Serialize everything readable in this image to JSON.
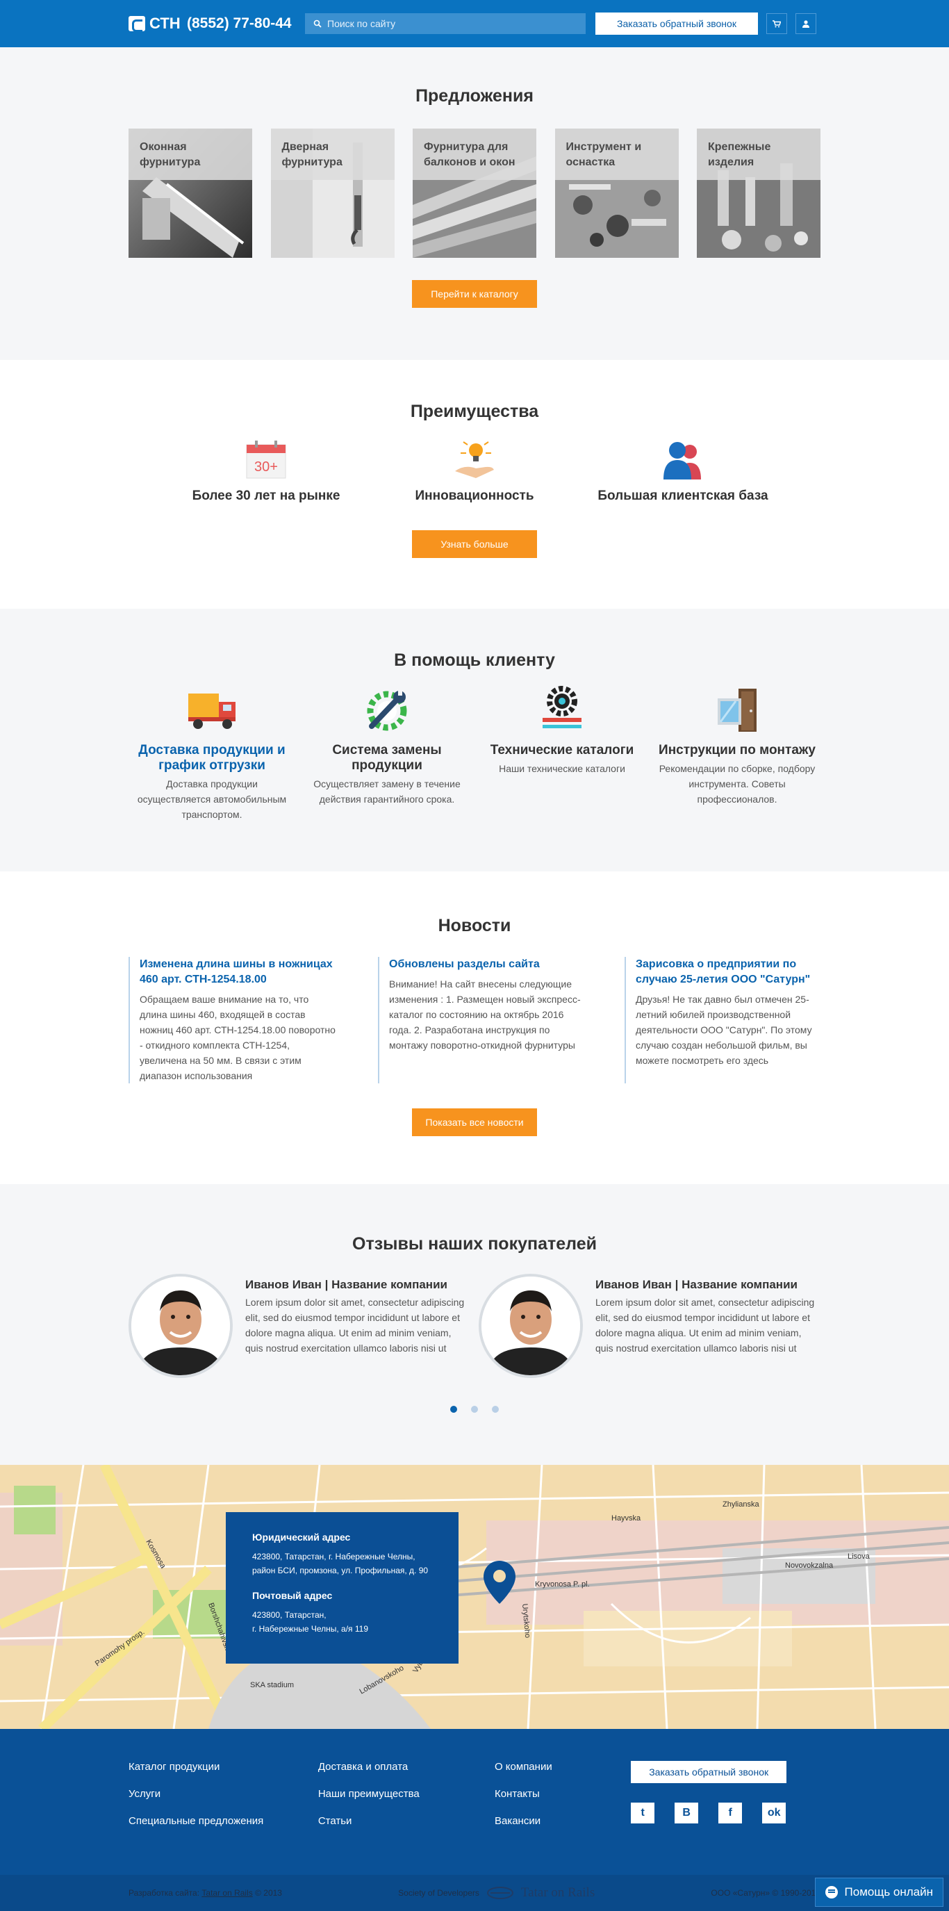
{
  "header": {
    "logo_text": "СТН",
    "phone": "(8552) 77-80-44",
    "search_placeholder": "Поиск по сайту",
    "callback_label": "Заказать обратный звонок",
    "brand_color": "#0a73c0"
  },
  "offers": {
    "title": "Предложения",
    "items": [
      {
        "label": "Оконная фурнитура"
      },
      {
        "label": "Дверная фурнитура"
      },
      {
        "label": "Фурнитура для балконов и окон"
      },
      {
        "label": "Инструмент и оснастка"
      },
      {
        "label": "Крепежные изделия"
      }
    ],
    "button": "Перейти к каталогу"
  },
  "advantages": {
    "title": "Преимущества",
    "items": [
      {
        "icon": "calendar-icon",
        "badge": "30+",
        "label": "Более 30 лет на рынке"
      },
      {
        "icon": "lightbulb-hand-icon",
        "label": "Инновационность"
      },
      {
        "icon": "users-icon",
        "label": "Большая клиентская база"
      }
    ],
    "button": "Узнать больше"
  },
  "help": {
    "title": "В помощь клиенту",
    "items": [
      {
        "icon": "truck-icon",
        "title": "Доставка продукции и график отгрузки",
        "desc": "Доставка продукции осуществляется автомобильным транспортом."
      },
      {
        "icon": "wrench-gear-icon",
        "title": "Система замены продукции",
        "desc": "Осуществляет замену в течение действия гарантийного срока."
      },
      {
        "icon": "gear-ruler-icon",
        "title": "Технические каталоги",
        "desc": "Наши технические каталоги"
      },
      {
        "icon": "window-door-icon",
        "title": "Инструкции по монтажу",
        "desc": "Рекомендации по сборке, подбору инструмента. Советы профессионалов."
      }
    ]
  },
  "news": {
    "title": "Новости",
    "items": [
      {
        "title": "Изменена длина шины в ножницах 460 арт. СТН-1254.18.00",
        "text": "Обращаем ваше внимание на то, что длина шины 460, входящей в состав ножниц 460 арт. СТН-1254.18.00 поворотно - откидного комплекта СТН-1254, увеличена на 50 мм. В связи с этим диапазон использования"
      },
      {
        "title": "Обновлены разделы сайта",
        "text": "Внимание! На сайт внесены следующие изменения : 1. Размещен новый экспресс-каталог по состоянию на октябрь 2016 года. 2. Разработана инструкция по монтажу поворотно-откидной фурнитуры"
      },
      {
        "title": "Зарисовка о предприятии по случаю 25-летия ООО \"Сатурн\"",
        "text": "Друзья! Не так давно был отмечен 25-летний юбилей производственной деятельности ООО \"Сатурн\". По этому случаю создан небольшой фильм, вы можете посмотреть его здесь"
      }
    ],
    "button": "Показать все новости"
  },
  "reviews": {
    "title": "Отзывы наших покупателей",
    "items": [
      {
        "name": "Иванов Иван | Название компании",
        "text": "Lorem ipsum dolor sit amet, consectetur adipiscing elit, sed do eiusmod tempor incididunt ut labore et dolore magna aliqua. Ut enim ad minim veniam, quis nostrud exercitation ullamco laboris nisi ut"
      },
      {
        "name": "Иванов Иван | Название компании",
        "text": "Lorem ipsum dolor sit amet, consectetur adipiscing elit, sed do eiusmod tempor incididunt ut labore et dolore magna aliqua. Ut enim ad minim veniam, quis nostrud exercitation ullamco laboris nisi ut"
      }
    ],
    "carousel_pages": 3,
    "active_page": 1
  },
  "map": {
    "legal_title": "Юридический адрес",
    "legal_address": "423800, Татарстан, г. Набережные Челны, район БСИ, промзона, ул. Профильная, д. 90",
    "postal_title": "Почтовый адрес",
    "postal_address_1": "423800, Татарстан,",
    "postal_address_2": "г. Набережные Челны, а/я 119",
    "street_labels": [
      "Kosmosa",
      "Paromohy prosp.",
      "Borshchahivska",
      "Urytskoho",
      "Kryvonosa P. pl.",
      "SKA stadium",
      "Lobanovskoho",
      "Novovokzalna",
      "Lisova",
      "Vyborna",
      "Hayvska",
      "Zhylianska"
    ]
  },
  "footer": {
    "col1": [
      "Каталог продукции",
      "Услуги",
      "Специальные предложения"
    ],
    "col2": [
      "Доставка и оплата",
      "Наши преимущества",
      "Статьи"
    ],
    "col3": [
      "О компании",
      "Контакты",
      "Вакансии"
    ],
    "callback_label": "Заказать обратный звонок",
    "socials": [
      {
        "icon": "twitter-icon",
        "glyph": "t"
      },
      {
        "icon": "vk-icon",
        "glyph": "В"
      },
      {
        "icon": "facebook-icon",
        "glyph": "f"
      },
      {
        "icon": "odnoklassniki-icon",
        "glyph": "ok"
      }
    ]
  },
  "bottom": {
    "dev_prefix": "Разработка сайта:",
    "dev_link": "Tatar on Rails",
    "dev_year": "© 2013",
    "society": "Society of Developers",
    "society_brand": "Tatar on Rails",
    "copyright": "ООО «Сатурн» © 1990-2013",
    "help_online": "Помощь онлайн"
  }
}
